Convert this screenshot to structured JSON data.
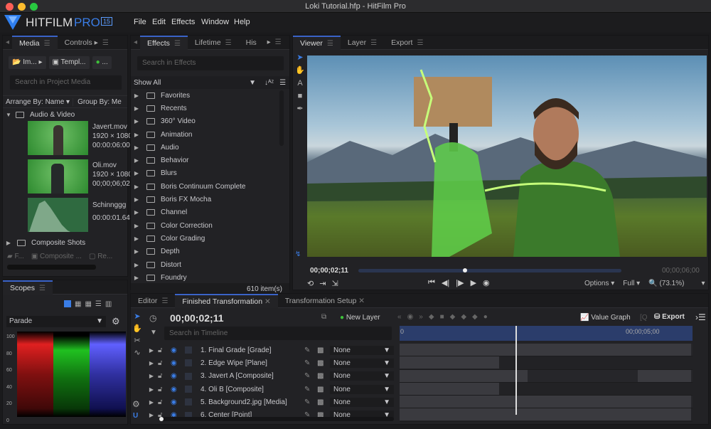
{
  "window": {
    "title": "Loki Tutorial.hfp - HitFilm Pro"
  },
  "app": {
    "logo_text": "HITFILM",
    "logo_pro": "PRO",
    "version_badge": "15"
  },
  "menu": [
    "File",
    "Edit",
    "Effects",
    "Window",
    "Help"
  ],
  "media_panel": {
    "tabs": [
      "Media",
      "Controls"
    ],
    "import_label": "Im...",
    "templates_label": "Templ...",
    "new_label": "...",
    "search_placeholder": "Search in Project Media",
    "arrange_by": "Arrange By: Name",
    "group_by": "Group By: Me",
    "folder": "Audio & Video",
    "items": [
      {
        "name": "Javert.mov",
        "res": "1920 × 1080",
        "dur": "00:00:06:00"
      },
      {
        "name": "Oli.mov",
        "res": "1920 × 1080",
        "dur": "00;00;06;02"
      },
      {
        "name": "Schinnggg",
        "res": "",
        "dur": "00:00:01.64"
      }
    ],
    "folder2": "Composite Shots",
    "footer": [
      "F...",
      "Composite ...",
      "Re..."
    ]
  },
  "effects_panel": {
    "tabs": [
      "Effects",
      "Lifetime",
      "His"
    ],
    "search_placeholder": "Search in Effects",
    "filter": "Show All",
    "items": [
      "Favorites",
      "Recents",
      "360° Video",
      "Animation",
      "Audio",
      "Behavior",
      "Blurs",
      "Boris Continuum Complete",
      "Boris FX Mocha",
      "Channel",
      "Color Correction",
      "Color Grading",
      "Depth",
      "Distort",
      "Foundry"
    ],
    "count": "610 item(s)"
  },
  "viewer": {
    "tabs": [
      "Viewer",
      "Layer",
      "Export"
    ],
    "current_time": "00;00;02;11",
    "end_time": "00;00;06;00",
    "progress": 0.397,
    "options": "Options",
    "quality": "Full",
    "zoom": "(73.1%)"
  },
  "scopes": {
    "tab": "Scopes",
    "mode": "Parade",
    "axis": [
      "100",
      "80",
      "60",
      "40",
      "20",
      "0"
    ]
  },
  "timeline": {
    "tabs": [
      "Editor",
      "Finished Transformation",
      "Transformation Setup"
    ],
    "time": "00;00;02;11",
    "new_layer": "New Layer",
    "value_graph": "Value Graph",
    "export": "Export",
    "search_placeholder": "Search in Timeline",
    "ruler": [
      "0",
      "00;00;05;00"
    ],
    "layers": [
      {
        "name": "1. Final Grade [Grade]",
        "blend": "None"
      },
      {
        "name": "2. Edge Wipe [Plane]",
        "blend": "None"
      },
      {
        "name": "3. Javert A [Composite]",
        "blend": "None"
      },
      {
        "name": "4. Oli B [Composite]",
        "blend": "None"
      },
      {
        "name": "5. Background2.jpg [Media]",
        "blend": "None"
      },
      {
        "name": "6. Center [Point]",
        "blend": "None"
      }
    ]
  },
  "colors": {
    "accent": "#3a63c8",
    "green": "#3ec23a"
  }
}
